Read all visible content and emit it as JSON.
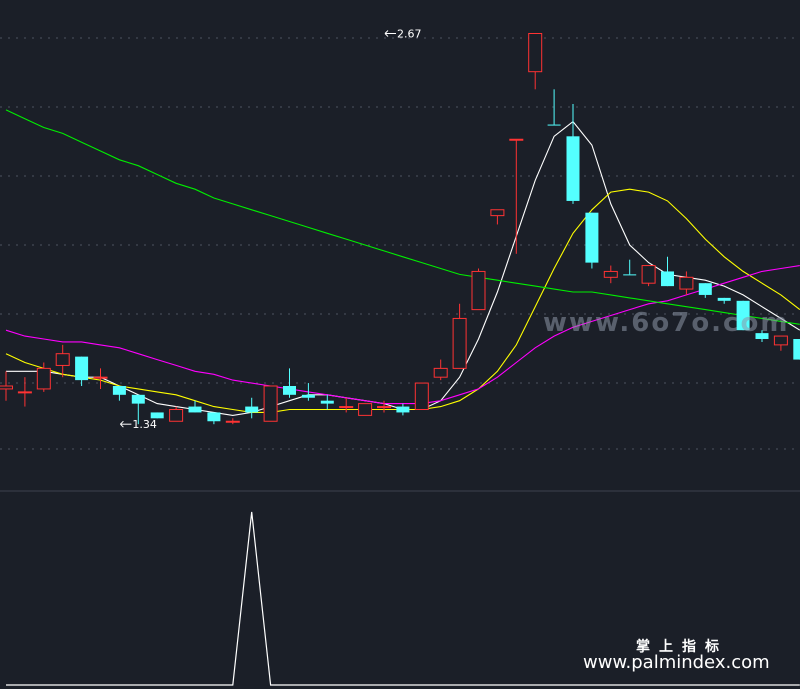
{
  "chart_data": [
    {
      "type": "candlestick",
      "panel": "price",
      "grid": true,
      "y_range": [
        1.15,
        2.75
      ],
      "annotations": [
        {
          "text": "2.67",
          "x": 20,
          "y": 2.67
        },
        {
          "text": "1.34",
          "x": 6,
          "y": 1.34
        }
      ],
      "candles": [
        {
          "open": 1.47,
          "high": 1.52,
          "low": 1.42,
          "close": 1.46,
          "color": "up"
        },
        {
          "open": 1.45,
          "high": 1.5,
          "low": 1.4,
          "close": 1.45,
          "color": "up"
        },
        {
          "open": 1.46,
          "high": 1.55,
          "low": 1.45,
          "close": 1.53,
          "color": "up"
        },
        {
          "open": 1.54,
          "high": 1.61,
          "low": 1.5,
          "close": 1.58,
          "color": "up"
        },
        {
          "open": 1.57,
          "high": 1.57,
          "low": 1.47,
          "close": 1.49,
          "color": "down"
        },
        {
          "open": 1.5,
          "high": 1.53,
          "low": 1.46,
          "close": 1.5,
          "color": "up"
        },
        {
          "open": 1.47,
          "high": 1.47,
          "low": 1.42,
          "close": 1.44,
          "color": "down"
        },
        {
          "open": 1.44,
          "high": 1.44,
          "low": 1.34,
          "close": 1.41,
          "color": "down"
        },
        {
          "open": 1.38,
          "high": 1.38,
          "low": 1.36,
          "close": 1.36,
          "color": "down"
        },
        {
          "open": 1.35,
          "high": 1.4,
          "low": 1.35,
          "close": 1.39,
          "color": "up"
        },
        {
          "open": 1.4,
          "high": 1.42,
          "low": 1.38,
          "close": 1.38,
          "color": "down"
        },
        {
          "open": 1.38,
          "high": 1.38,
          "low": 1.34,
          "close": 1.35,
          "color": "down"
        },
        {
          "open": 1.35,
          "high": 1.36,
          "low": 1.34,
          "close": 1.35,
          "color": "up"
        },
        {
          "open": 1.4,
          "high": 1.43,
          "low": 1.36,
          "close": 1.38,
          "color": "down"
        },
        {
          "open": 1.35,
          "high": 1.47,
          "low": 1.35,
          "close": 1.47,
          "color": "up"
        },
        {
          "open": 1.47,
          "high": 1.53,
          "low": 1.43,
          "close": 1.44,
          "color": "down"
        },
        {
          "open": 1.44,
          "high": 1.48,
          "low": 1.42,
          "close": 1.43,
          "color": "down"
        },
        {
          "open": 1.42,
          "high": 1.44,
          "low": 1.39,
          "close": 1.41,
          "color": "down"
        },
        {
          "open": 1.4,
          "high": 1.43,
          "low": 1.38,
          "close": 1.4,
          "color": "up"
        },
        {
          "open": 1.37,
          "high": 1.41,
          "low": 1.37,
          "close": 1.41,
          "color": "up"
        },
        {
          "open": 1.4,
          "high": 1.42,
          "low": 1.38,
          "close": 1.4,
          "color": "up"
        },
        {
          "open": 1.4,
          "high": 1.41,
          "low": 1.37,
          "close": 1.38,
          "color": "down"
        },
        {
          "open": 1.39,
          "high": 1.48,
          "low": 1.39,
          "close": 1.48,
          "color": "up"
        },
        {
          "open": 1.5,
          "high": 1.56,
          "low": 1.49,
          "close": 1.53,
          "color": "up"
        },
        {
          "open": 1.53,
          "high": 1.75,
          "low": 1.53,
          "close": 1.7,
          "color": "up"
        },
        {
          "open": 1.73,
          "high": 1.87,
          "low": 1.73,
          "close": 1.86,
          "color": "up"
        },
        {
          "open": 2.05,
          "high": 2.07,
          "low": 2.02,
          "close": 2.07,
          "color": "up"
        },
        {
          "open": 2.31,
          "high": 2.31,
          "low": 1.92,
          "close": 2.31,
          "color": "up"
        },
        {
          "open": 2.54,
          "high": 2.67,
          "low": 2.48,
          "close": 2.67,
          "color": "up"
        },
        {
          "open": 2.36,
          "high": 2.48,
          "low": 2.36,
          "close": 2.36,
          "color": "down"
        },
        {
          "open": 2.32,
          "high": 2.43,
          "low": 2.09,
          "close": 2.1,
          "color": "down"
        },
        {
          "open": 2.06,
          "high": 2.06,
          "low": 1.87,
          "close": 1.89,
          "color": "down"
        },
        {
          "open": 1.84,
          "high": 1.88,
          "low": 1.82,
          "close": 1.86,
          "color": "up"
        },
        {
          "open": 1.85,
          "high": 1.9,
          "low": 1.85,
          "close": 1.85,
          "color": "down"
        },
        {
          "open": 1.82,
          "high": 1.88,
          "low": 1.81,
          "close": 1.88,
          "color": "up"
        },
        {
          "open": 1.86,
          "high": 1.91,
          "low": 1.81,
          "close": 1.81,
          "color": "down"
        },
        {
          "open": 1.8,
          "high": 1.86,
          "low": 1.78,
          "close": 1.84,
          "color": "up"
        },
        {
          "open": 1.82,
          "high": 1.82,
          "low": 1.77,
          "close": 1.78,
          "color": "down"
        },
        {
          "open": 1.77,
          "high": 1.77,
          "low": 1.75,
          "close": 1.76,
          "color": "down"
        },
        {
          "open": 1.76,
          "high": 1.76,
          "low": 1.66,
          "close": 1.66,
          "color": "down"
        },
        {
          "open": 1.65,
          "high": 1.66,
          "low": 1.62,
          "close": 1.63,
          "color": "down"
        },
        {
          "open": 1.61,
          "high": 1.64,
          "low": 1.59,
          "close": 1.64,
          "color": "up"
        },
        {
          "open": 1.63,
          "high": 1.63,
          "low": 1.56,
          "close": 1.56,
          "color": "down"
        }
      ],
      "series": [
        {
          "line": "white",
          "values": [
            1.52,
            1.52,
            1.52,
            1.51,
            1.5,
            1.5,
            1.47,
            1.44,
            1.41,
            1.4,
            1.39,
            1.38,
            1.37,
            1.38,
            1.4,
            1.42,
            1.44,
            1.44,
            1.43,
            1.42,
            1.41,
            1.39,
            1.39,
            1.42,
            1.5,
            1.63,
            1.79,
            1.98,
            2.17,
            2.32,
            2.37,
            2.29,
            2.09,
            1.95,
            1.89,
            1.85,
            1.84,
            1.83,
            1.81,
            1.78,
            1.74,
            1.7,
            1.66
          ]
        },
        {
          "line": "yellow",
          "values": [
            1.58,
            1.55,
            1.53,
            1.51,
            1.5,
            1.49,
            1.47,
            1.46,
            1.45,
            1.44,
            1.42,
            1.4,
            1.39,
            1.38,
            1.38,
            1.39,
            1.39,
            1.39,
            1.39,
            1.39,
            1.39,
            1.39,
            1.39,
            1.4,
            1.42,
            1.46,
            1.52,
            1.61,
            1.74,
            1.87,
            1.99,
            2.07,
            2.13,
            2.14,
            2.13,
            2.1,
            2.04,
            1.97,
            1.91,
            1.86,
            1.82,
            1.78,
            1.73
          ]
        },
        {
          "line": "magenta",
          "values": [
            1.66,
            1.64,
            1.63,
            1.62,
            1.62,
            1.61,
            1.6,
            1.58,
            1.56,
            1.54,
            1.52,
            1.51,
            1.49,
            1.48,
            1.47,
            1.46,
            1.45,
            1.44,
            1.43,
            1.42,
            1.41,
            1.41,
            1.41,
            1.42,
            1.44,
            1.46,
            1.5,
            1.55,
            1.6,
            1.64,
            1.67,
            1.69,
            1.71,
            1.73,
            1.75,
            1.76,
            1.78,
            1.8,
            1.82,
            1.84,
            1.86,
            1.87,
            1.88
          ]
        },
        {
          "line": "green",
          "values": [
            2.41,
            2.38,
            2.35,
            2.33,
            2.3,
            2.27,
            2.24,
            2.22,
            2.19,
            2.16,
            2.14,
            2.11,
            2.09,
            2.07,
            2.05,
            2.03,
            2.01,
            1.99,
            1.97,
            1.95,
            1.93,
            1.91,
            1.89,
            1.87,
            1.85,
            1.84,
            1.83,
            1.82,
            1.81,
            1.8,
            1.79,
            1.79,
            1.78,
            1.77,
            1.76,
            1.75,
            1.74,
            1.73,
            1.72,
            1.71,
            1.7,
            1.69,
            1.68
          ]
        }
      ]
    },
    {
      "type": "line",
      "panel": "indicator",
      "grid": false,
      "y_range": [
        0,
        1
      ],
      "values": [
        0,
        0,
        0,
        0,
        0,
        0,
        0,
        0,
        0,
        0,
        0,
        0,
        0,
        1,
        0,
        0,
        0,
        0,
        0,
        0,
        0,
        0,
        0,
        0,
        0,
        0,
        0,
        0,
        0,
        0,
        0,
        0,
        0,
        0,
        0,
        0,
        0,
        0,
        0,
        0,
        0,
        0,
        0
      ]
    }
  ],
  "colors": {
    "background": "#1b1f28",
    "up": "#ff3333",
    "down": "#54ffff",
    "white_line": "#ffffff",
    "yellow_line": "#ffff00",
    "magenta_line": "#ff00ff",
    "green_line": "#00ee00",
    "grid": "#5a6070",
    "divider": "#3c424e"
  },
  "watermarks": {
    "center": "www.6o7o.com",
    "bottom_cn": "掌上指标",
    "bottom_url": "www.palmindex.com"
  }
}
